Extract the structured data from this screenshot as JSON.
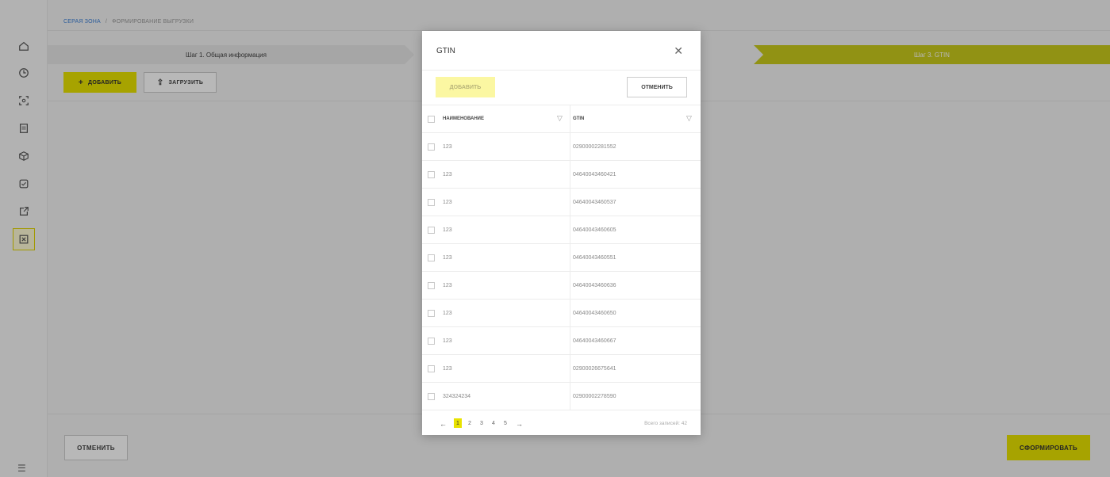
{
  "breadcrumb": {
    "root": "СЕРАЯ ЗОНА",
    "current": "ФОРМИРОВАНИЕ ВЫГРУЗКИ"
  },
  "steps": {
    "step1": "Шаг 1. Общая информация",
    "step3": "Шаг 3. GTIN"
  },
  "toolbar": {
    "add_label": "ДОБАВИТЬ",
    "upload_label": "ЗАГРУЗИТЬ"
  },
  "footer": {
    "cancel_label": "ОТМЕНИТЬ",
    "submit_label": "СФОРМИРОВАТЬ"
  },
  "modal": {
    "title": "GTIN",
    "add_label": "ДОБАВИТЬ",
    "cancel_label": "ОТМЕНИТЬ",
    "columns": {
      "name": "НАИМЕНОВАНИЕ",
      "gtin": "GTIN"
    },
    "rows": [
      {
        "name": "123",
        "gtin": "02900002281552"
      },
      {
        "name": "123",
        "gtin": "04640043460421"
      },
      {
        "name": "123",
        "gtin": "04640043460537"
      },
      {
        "name": "123",
        "gtin": "04640043460605"
      },
      {
        "name": "123",
        "gtin": "04640043460551"
      },
      {
        "name": "123",
        "gtin": "04640043460636"
      },
      {
        "name": "123",
        "gtin": "04640043460650"
      },
      {
        "name": "123",
        "gtin": "04640043460667"
      },
      {
        "name": "123",
        "gtin": "02900026675641"
      },
      {
        "name": "324324234",
        "gtin": "02900002278590"
      }
    ],
    "pagination": {
      "pages": [
        "1",
        "2",
        "3",
        "4",
        "5"
      ],
      "current": "1",
      "prev": "←",
      "next": "→"
    },
    "total": "Всего записей: 42"
  },
  "colors": {
    "accent": "#e8e200",
    "step_active": "#c9cb1c",
    "link": "#3b7fd6"
  },
  "icons": [
    "home-icon",
    "clock-icon",
    "scan-icon",
    "document-icon",
    "box-icon",
    "check-icon",
    "export-icon",
    "close-square-icon",
    "menu-icon",
    "close-icon",
    "filter-icon",
    "upload-icon",
    "plus-icon"
  ]
}
